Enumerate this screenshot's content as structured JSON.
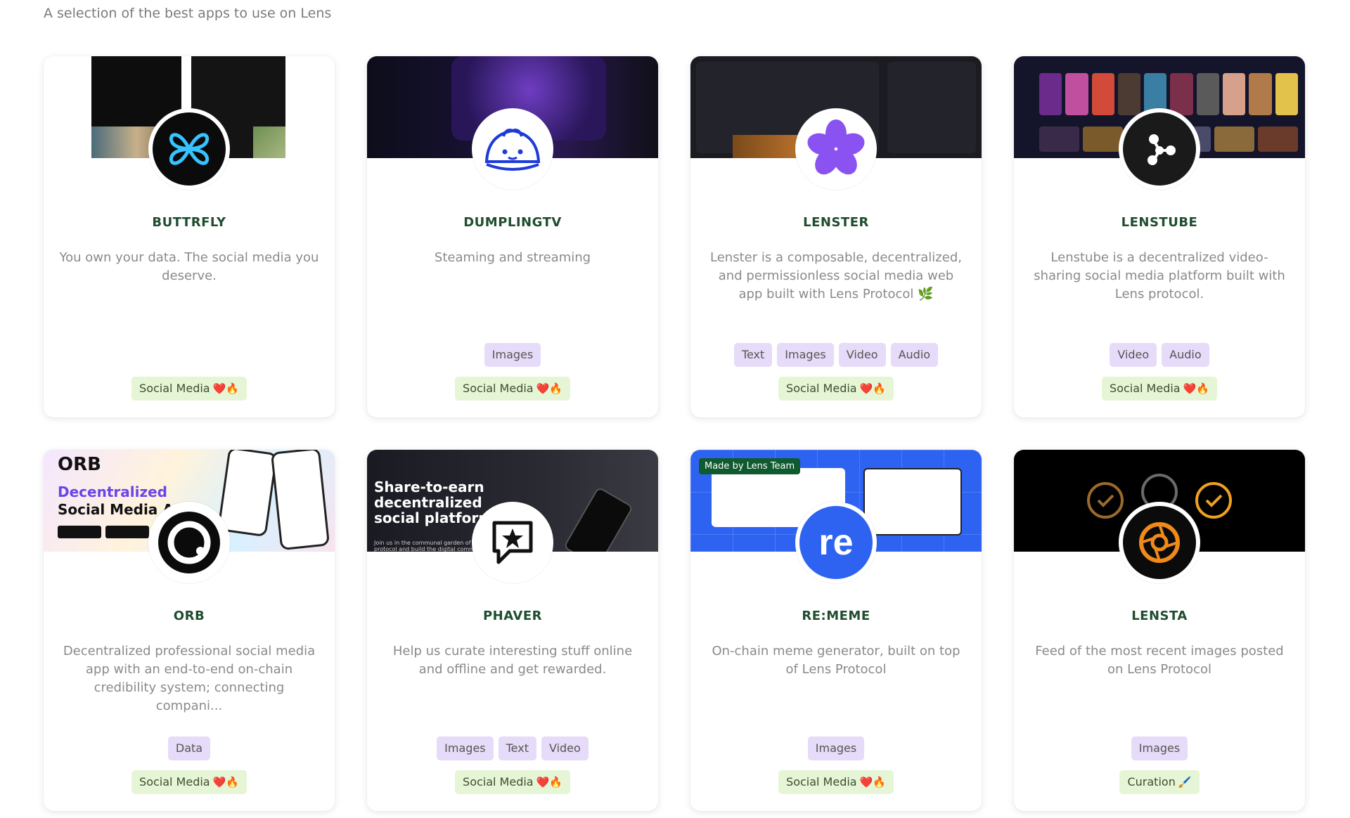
{
  "page": {
    "subtitle": "A selection of the best apps to use on Lens"
  },
  "cards": [
    {
      "name": "BUTTRFLY",
      "description": "You own your data. The social media you deserve.",
      "tags": [],
      "category": "Social Media",
      "category_emoji": "❤️🔥",
      "logo_icon": "butterfly-icon"
    },
    {
      "name": "DUMPLINGTV",
      "description": "Steaming and streaming",
      "tags": [
        "Images"
      ],
      "category": "Social Media",
      "category_emoji": "❤️🔥",
      "logo_icon": "dumpling-icon"
    },
    {
      "name": "LENSTER",
      "description": "Lenster is a composable, decentralized, and permissionless social media web app built with Lens Protocol 🌿",
      "tags": [
        "Text",
        "Images",
        "Video",
        "Audio"
      ],
      "category": "Social Media",
      "category_emoji": "❤️🔥",
      "logo_icon": "flower-icon"
    },
    {
      "name": "LENSTUBE",
      "description": "Lenstube is a decentralized video-sharing social media platform built with Lens protocol.",
      "tags": [
        "Video",
        "Audio"
      ],
      "category": "Social Media",
      "category_emoji": "❤️🔥",
      "logo_icon": "node-graph-icon"
    },
    {
      "name": "ORB",
      "description": "Decentralized professional social media app with an end-to-end on-chain credibility system; connecting compani...",
      "tags": [
        "Data"
      ],
      "category": "Social Media",
      "category_emoji": "❤️🔥",
      "logo_icon": "orb-ring-icon",
      "banner_title": "ORB",
      "banner_text_highlight": "Decentralized",
      "banner_text_rest": " Social Media App"
    },
    {
      "name": "PHAVER",
      "description": "Help us curate interesting stuff online and offline and get rewarded.",
      "tags": [
        "Images",
        "Text",
        "Video"
      ],
      "category": "Social Media",
      "category_emoji": "❤️🔥",
      "logo_icon": "star-chat-icon",
      "banner_text": "Share-to-earn decentralized social platform",
      "banner_small": "Join us in the communal garden of Lens protocol and build the digital commons"
    },
    {
      "name": "RE:MEME",
      "description": "On-chain meme generator, built on top of Lens Protocol",
      "tags": [
        "Images"
      ],
      "category": "Social Media",
      "category_emoji": "❤️🔥",
      "logo_icon": "re-text-icon",
      "banner_badge": "Made by Lens Team",
      "logo_text": "re"
    },
    {
      "name": "LENSTA",
      "description": "Feed of the most recent images posted on Lens Protocol",
      "tags": [
        "Images"
      ],
      "category": "Curation",
      "category_emoji": "🖌️",
      "logo_icon": "aperture-icon"
    }
  ],
  "colors": {
    "name_text": "#1f4d2e",
    "tag_bg": "#e6dbf8",
    "category_bg": "#e6f5d6"
  }
}
